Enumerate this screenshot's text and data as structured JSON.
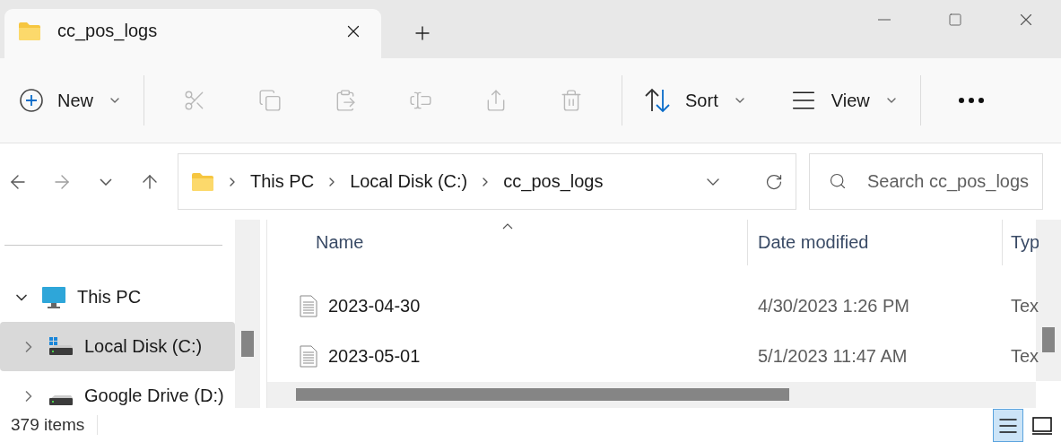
{
  "tab": {
    "title": "cc_pos_logs",
    "selected": true
  },
  "toolbar": {
    "new_button": {
      "label": "New"
    },
    "actions": [
      {
        "disabled": true
      },
      {
        "disabled": true
      },
      {
        "disabled": true
      },
      {
        "disabled": true
      },
      {
        "disabled": true
      },
      {
        "disabled": true
      }
    ],
    "sort_button": {
      "label": "Sort"
    },
    "view_button": {
      "label": "View"
    }
  },
  "nav": [
    {
      "disabled": false
    },
    {
      "disabled": true
    },
    {
      "disabled": false
    },
    {
      "disabled": false
    }
  ],
  "breadcrumb": [
    "This PC",
    "Local Disk (C:)",
    "cc_pos_logs"
  ],
  "search": {
    "placeholder": "Search cc_pos_logs"
  },
  "sidebar": {
    "items": [
      {
        "label": "This PC",
        "expanded": true,
        "selected": false,
        "children": [
          {
            "label": "Local Disk (C:)",
            "expanded": false,
            "selected": true
          },
          {
            "label": "Google Drive (D:)",
            "expanded": false,
            "selected": false
          }
        ]
      }
    ]
  },
  "table": {
    "columns": [
      {
        "label": "Name",
        "sorted": true
      },
      {
        "label": "Date modified",
        "sorted": false
      },
      {
        "label": "Typ",
        "sorted": false
      }
    ],
    "rows": [
      {
        "name": "2023-04-30",
        "date": "4/30/2023 1:26 PM",
        "type": "Tex"
      },
      {
        "name": "2023-05-01",
        "date": "5/1/2023 11:47 AM",
        "type": "Tex"
      }
    ]
  },
  "status_bar": {
    "count": "379 items",
    "views": [
      {
        "selected": true
      },
      {
        "selected": false
      }
    ]
  }
}
